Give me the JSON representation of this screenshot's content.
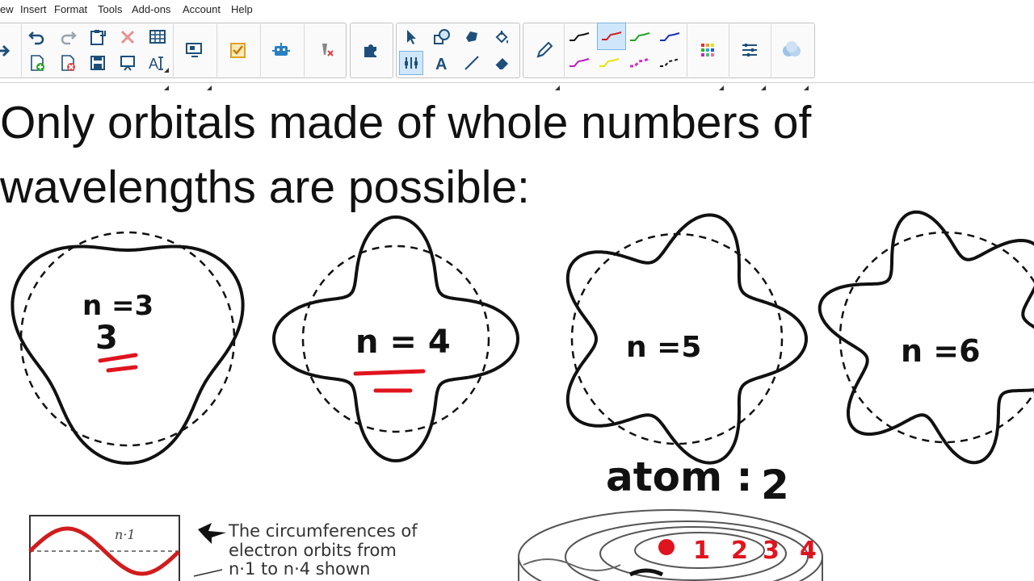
{
  "menu": [
    "ew",
    "Insert",
    "Format",
    "Tools",
    "Add-ons",
    "Account",
    "Help"
  ],
  "toolbar_icons": {
    "undo": "undo-icon",
    "redo": "redo-icon",
    "clipboard": "clipboard-icon",
    "delete": "delete-x-icon",
    "table": "table-icon",
    "add_page": "add-page-icon",
    "delete_page": "delete-page-icon",
    "save": "save-icon",
    "screen": "screen-icon",
    "text_size": "text-size-icon",
    "display": "display-icon",
    "checkbox": "checkbox-icon",
    "robot": "robot-icon",
    "pen_off": "pen-off-icon",
    "puzzle": "puzzle-icon",
    "select": "pointer-icon",
    "shape": "shape-icon",
    "fill": "fill-bucket-icon",
    "lasso": "lasso-icon",
    "multi_select": "multi-select-icon",
    "text": "text-tool-icon",
    "line": "line-tool-icon",
    "eraser": "eraser-icon",
    "pen": "pen-icon",
    "color_palette": "color-palette-icon",
    "properties": "properties-icon",
    "layers": "layers-icon"
  },
  "text_tool_letter": "A",
  "text_size_letters": "A",
  "pen_colors": [
    "#111111",
    "#d11c1c",
    "#1fa51f",
    "#1a2fb8",
    "#c219c2",
    "#e6e600",
    "#d12bd1",
    "#111111"
  ],
  "page": {
    "title_line1": "Only orbitals made of whole numbers of",
    "title_line2": "wavelengths are possible:"
  },
  "orbitals": [
    {
      "label": "n =3",
      "n": 3,
      "annotation": "3"
    },
    {
      "label": "n = 4",
      "n": 4
    },
    {
      "label": "n =5",
      "n": 5
    },
    {
      "label": "n =6",
      "n": 6
    }
  ],
  "atom_note": {
    "text": "atom :",
    "digit": "2"
  },
  "bohr_figure": {
    "wave_label": "n·1",
    "caption_lines": [
      "The circumferences of",
      "electron orbits from",
      "n·1 to n·4  shown"
    ]
  },
  "orbit_numbers": [
    "1",
    "2",
    "3",
    "4"
  ],
  "colors": {
    "ink": "#111111",
    "red_ink": "#e0141e",
    "highlight": "#cfe6fb"
  }
}
